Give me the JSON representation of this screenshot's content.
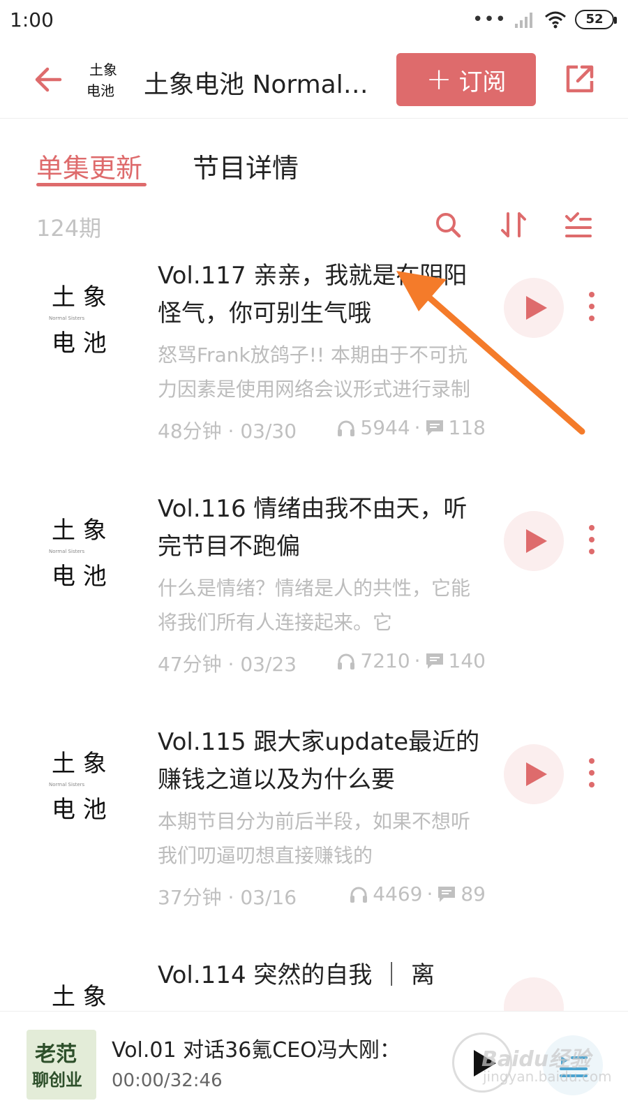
{
  "status_bar": {
    "time": "1:00",
    "battery": "52"
  },
  "header": {
    "logo_text": [
      "土象",
      "电池"
    ],
    "title": "土象电池 Normal Sisters",
    "subscribe_label": "订阅"
  },
  "tabs": [
    {
      "label": "单集更新",
      "active": true
    },
    {
      "label": "节目详情",
      "active": false
    }
  ],
  "toolbar": {
    "episode_count": "124期"
  },
  "cover_art": {
    "line1": "土 象",
    "line2": "电 池",
    "subtitle": "Normal Sisters"
  },
  "episodes": [
    {
      "title": "Vol.117 亲亲，我就是在阴阳怪气，你可别生气哦",
      "description": "怒骂Frank放鸽子!! 本期由于不可抗力因素是使用网络会议形式进行录制",
      "duration": "48分钟",
      "date": "03/30",
      "plays": "5944",
      "comments": "118"
    },
    {
      "title": "Vol.116 情绪由我不由天，听完节目不跑偏",
      "description": "什么是情绪？情绪是人的共性，它能将我们所有人连接起来。它",
      "duration": "47分钟",
      "date": "03/23",
      "plays": "7210",
      "comments": "140"
    },
    {
      "title": "Vol.115 跟大家update最近的赚钱之道以及为什么要",
      "description": "本期节目分为前后半段，如果不想听我们叨逼叨想直接赚钱的",
      "duration": "37分钟",
      "date": "03/16",
      "plays": "4469",
      "comments": "89"
    },
    {
      "title": "Vol.114 突然的自我 ｜ 离"
    }
  ],
  "player": {
    "cover_text": [
      "老范",
      "聊创业"
    ],
    "title": "Vol.01 对话36氪CEO冯大刚：",
    "time": "00:00/32:46"
  },
  "watermark": {
    "brand": "Baidu经验",
    "url": "jingyan.baidu.com"
  },
  "colors": {
    "accent": "#de6b6c",
    "annotation": "#f47b2a"
  }
}
